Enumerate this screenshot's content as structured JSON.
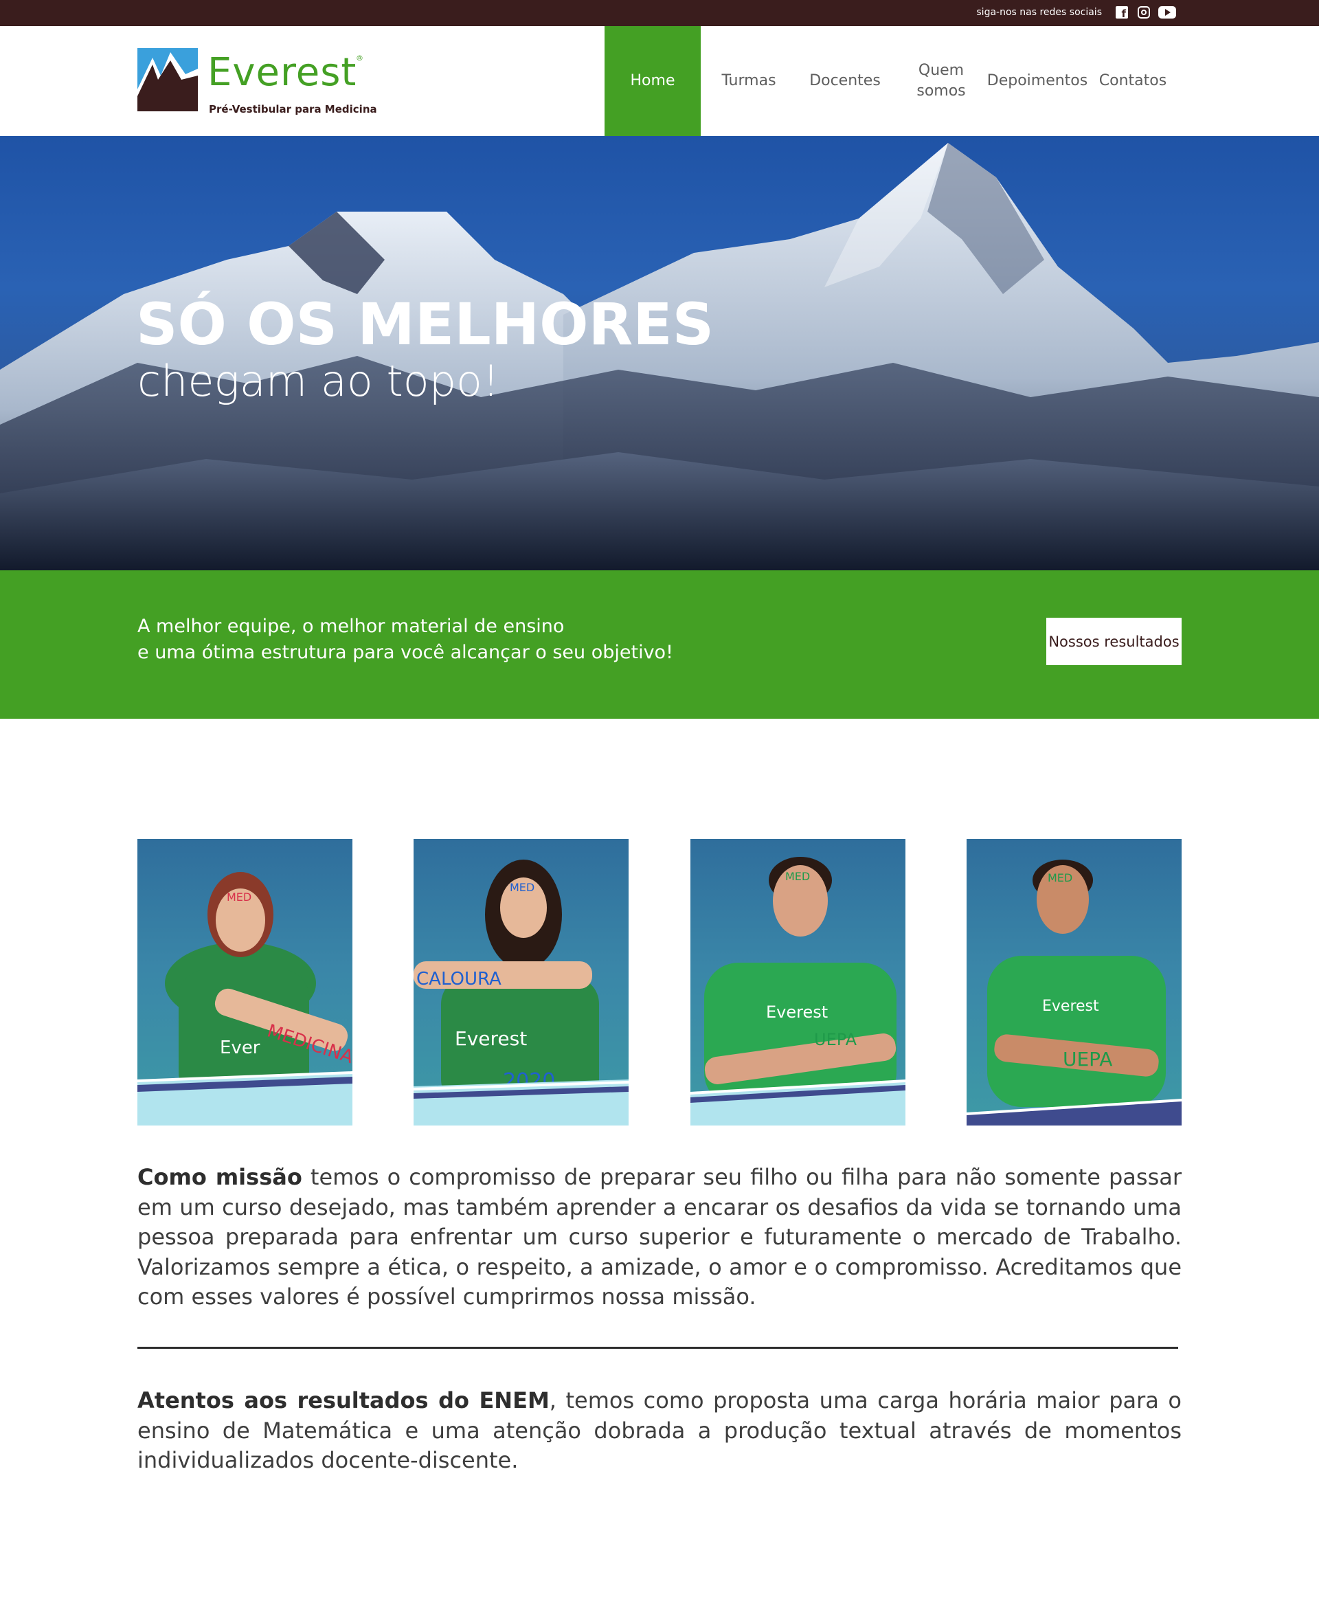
{
  "topbar": {
    "follow_text": "siga-nos nas redes sociais",
    "socials": [
      "facebook-icon",
      "instagram-icon",
      "youtube-icon"
    ]
  },
  "brand": {
    "name": "Everest",
    "registered": "®",
    "tagline": "Pré-Vestibular para Medicina"
  },
  "nav": {
    "items": [
      {
        "label": "Home",
        "active": true
      },
      {
        "label": "Turmas",
        "active": false
      },
      {
        "label": "Docentes",
        "active": false
      },
      {
        "label": "Quem somos",
        "active": false
      },
      {
        "label": "Depoimentos",
        "active": false
      },
      {
        "label": "Contatos",
        "active": false
      }
    ]
  },
  "hero": {
    "title": "SÓ OS MELHORES",
    "subtitle": "chegam ao topo!"
  },
  "banner": {
    "line1": "A melhor equipe, o melhor material de ensino",
    "line2": "e uma ótima estrutura para você alcançar o seu objetivo!",
    "button_label": "Nossos resultados"
  },
  "photos": [
    {
      "face_text": "MED",
      "arm_text": "MEDICINA",
      "shirt_text": "Ever"
    },
    {
      "face_text": "MED",
      "arm_text": "CALOURA",
      "shirt_text": "Everest",
      "year_text": "2020"
    },
    {
      "face_text": "MED",
      "arm_text": "UEPA",
      "shirt_text": "Everest"
    },
    {
      "face_text": "MED",
      "arm_text": "UEPA",
      "shirt_text": "Everest"
    }
  ],
  "mission": {
    "lead": "Como missão",
    "text": " temos o compromisso de preparar seu filho ou filha para não somente passar em um curso desejado, mas também aprender a encarar os desafios da vida se tornando uma pessoa preparada para enfrentar um curso superior e futuramente o mercado de Trabalho. Valorizamos sempre a ética, o respeito, a amizade, o amor e o compromisso. Acreditamos que com esses valores é possível cumprirmos nossa missão."
  },
  "enem": {
    "lead": "Atentos aos resultados do ENEM",
    "text": ", temos como proposta uma carga horária maior para o ensino de Matemática e uma atenção dobrada a produção textual através de momentos individualizados docente-discente."
  },
  "colors": {
    "brand_green": "#44a024",
    "topbar_brown": "#3a1d1d",
    "sky_blue": "#2a62b4"
  }
}
